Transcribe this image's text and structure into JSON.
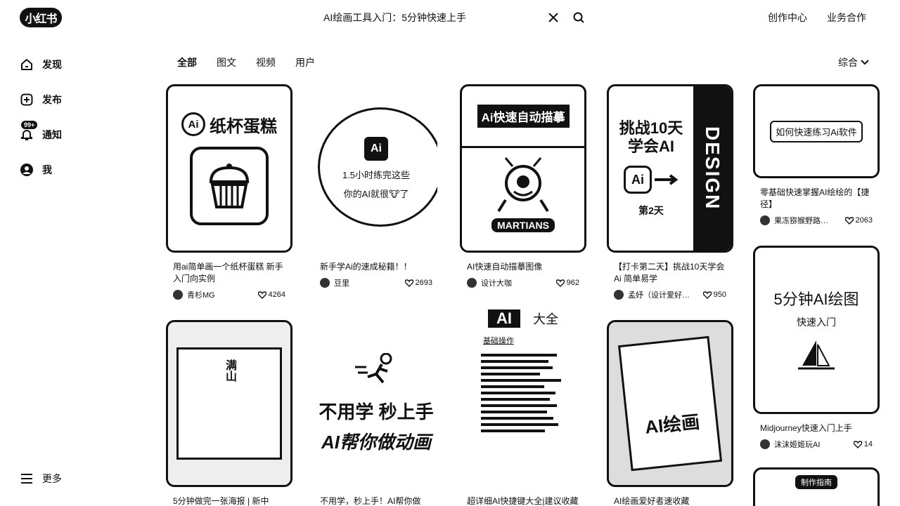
{
  "header": {
    "logo": "小红书",
    "search_query": "AI绘画工具入门：5分钟快速上手",
    "links": [
      "创作中心",
      "业务合作"
    ]
  },
  "sidebar": {
    "items": [
      {
        "label": "发现",
        "icon": "home-icon"
      },
      {
        "label": "发布",
        "icon": "plus-square-icon"
      },
      {
        "label": "通知",
        "icon": "bell-icon",
        "badge": "99+"
      },
      {
        "label": "我",
        "icon": "avatar-icon"
      }
    ],
    "more": "更多"
  },
  "tabs": [
    "全部",
    "图文",
    "视频",
    "用户"
  ],
  "sort_label": "综合",
  "cards": [
    {
      "title": "用ai简单画一个纸杯蛋糕 新手入门向实例",
      "author": "青杉MG",
      "likes": "4264",
      "thumb_text": "纸杯蛋糕",
      "thumb_badge": "Ai"
    },
    {
      "title": "新手学Ai的速成秘籍！！",
      "author": "豆里",
      "likes": "2693",
      "thumb_text": "1.5小时练完这些",
      "thumb_text2": "你的AI就很🐮了",
      "thumb_badge": "Ai"
    },
    {
      "title": "AI快速自动描摹图像",
      "author": "设计大咖",
      "likes": "962",
      "thumb_text": "Ai快速自动描摹",
      "thumb_text2": "MARTIANS"
    },
    {
      "title": "【打卡第二天】挑战10天学会Ai 简单易学",
      "author": "孟妤（设计爱好…",
      "likes": "950",
      "thumb_text": "挑战10天学会AI",
      "thumb_text2": "DESIGN",
      "thumb_text3": "第2天"
    },
    {
      "title": "零基础快速掌握AI绘绘的【捷径】",
      "author": "果冻猕猴野路…",
      "likes": "2063",
      "thumb_text": "如何快速练习Ai软件"
    },
    {
      "title": "5分钟做完一张海报 | 新中",
      "thumb_text": "满山"
    },
    {
      "title": "不用学，秒上手！AI帮你做MG动画视频",
      "thumb_text": "不用学 秒上手",
      "thumb_text2": "AI帮你做动画"
    },
    {
      "title": "超详细AI快捷键大全|建议收藏",
      "thumb_text": "大全",
      "thumb_text2": "基础操作"
    },
    {
      "title": "AI绘画爱好者速收藏",
      "thumb_text": "AI绘画"
    },
    {
      "title": "Midjourney快速入门上手",
      "author": "沫沫姬姬玩AI",
      "likes": "14",
      "thumb_text": "5分钟AI绘图",
      "thumb_text2": "快速入门"
    },
    {
      "thumb_text": "制作指南"
    }
  ]
}
